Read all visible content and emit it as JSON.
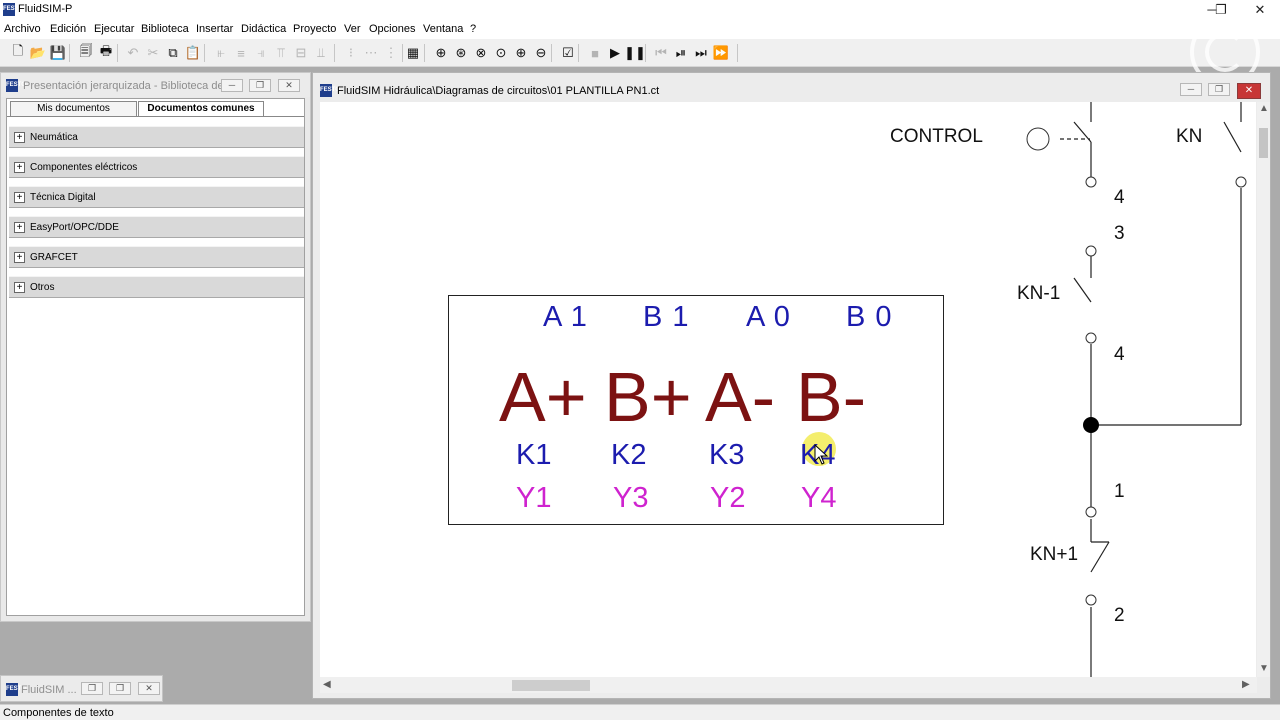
{
  "app": {
    "title": "FluidSIM-P",
    "logo_text": "FESTO",
    "window_controls": {
      "minimize": "─",
      "restore": "❐",
      "close": "✕"
    }
  },
  "menu": [
    "Archivo",
    "Edición",
    "Ejecutar",
    "Biblioteca",
    "Insertar",
    "Didáctica",
    "Proyecto",
    "Ver",
    "Opciones",
    "Ventana",
    "?"
  ],
  "toolbar": {
    "buttons": [
      {
        "icon": "new-document-icon",
        "glyph": "🗋",
        "enabled": true
      },
      {
        "icon": "open-icon",
        "glyph": "📂",
        "enabled": true
      },
      {
        "icon": "save-icon",
        "glyph": "💾",
        "enabled": true
      },
      {
        "icon": "print-preview-icon",
        "glyph": "🗐",
        "enabled": true
      },
      {
        "icon": "print-icon",
        "glyph": "🖶",
        "enabled": true
      },
      {
        "icon": "undo-icon",
        "glyph": "↶",
        "enabled": false
      },
      {
        "icon": "cut-icon",
        "glyph": "✂",
        "enabled": false
      },
      {
        "icon": "copy-icon",
        "glyph": "⧉",
        "enabled": true
      },
      {
        "icon": "paste-icon",
        "glyph": "📋",
        "enabled": true
      },
      {
        "icon": "align-left-icon",
        "glyph": "⫦",
        "enabled": false
      },
      {
        "icon": "align-center-icon",
        "glyph": "≡",
        "enabled": false
      },
      {
        "icon": "align-right-icon",
        "glyph": "⫣",
        "enabled": false
      },
      {
        "icon": "align-top-icon",
        "glyph": "⫪",
        "enabled": false
      },
      {
        "icon": "align-middle-icon",
        "glyph": "⊟",
        "enabled": false
      },
      {
        "icon": "align-bottom-icon",
        "glyph": "⫫",
        "enabled": false
      },
      {
        "icon": "distribute-h-icon",
        "glyph": "⁝",
        "enabled": false
      },
      {
        "icon": "distribute-v-icon",
        "glyph": "⋯",
        "enabled": false
      },
      {
        "icon": "grid-icon",
        "glyph": "⋮",
        "enabled": false
      },
      {
        "icon": "component-list-icon",
        "glyph": "▦",
        "enabled": true
      },
      {
        "icon": "zoom-fit-icon",
        "glyph": "⊕",
        "enabled": true
      },
      {
        "icon": "zoom-window-icon",
        "glyph": "⊛",
        "enabled": true
      },
      {
        "icon": "zoom-previous-icon",
        "glyph": "⊗",
        "enabled": true
      },
      {
        "icon": "zoom-page-icon",
        "glyph": "⊙",
        "enabled": true
      },
      {
        "icon": "zoom-in-icon",
        "glyph": "⊕",
        "enabled": true
      },
      {
        "icon": "zoom-out-icon",
        "glyph": "⊖",
        "enabled": true
      },
      {
        "icon": "check-drawing-icon",
        "glyph": "☑",
        "enabled": true
      },
      {
        "icon": "stop-icon",
        "glyph": "■",
        "enabled": false
      },
      {
        "icon": "play-icon",
        "glyph": "▶",
        "enabled": true
      },
      {
        "icon": "pause-icon",
        "glyph": "❚❚",
        "enabled": true
      },
      {
        "icon": "reset-icon",
        "glyph": "⏮",
        "enabled": false
      },
      {
        "icon": "step-icon",
        "glyph": "⏯",
        "enabled": true
      },
      {
        "icon": "step-to-state-icon",
        "glyph": "⏭",
        "enabled": true
      },
      {
        "icon": "fast-forward-icon",
        "glyph": "⏩",
        "enabled": false
      }
    ]
  },
  "library_panel": {
    "title": "Presentación jerarquizada - Biblioteca de ...",
    "tabs": [
      "Mis documentos",
      "Documentos comunes"
    ],
    "active_tab": 1,
    "categories": [
      "Neumática",
      "Componentes eléctricos",
      "Técnica Digital",
      "EasyPort/OPC/DDE",
      "GRAFCET",
      "Otros"
    ],
    "expand_glyph": "+"
  },
  "minimized_window": {
    "title": "FluidSIM ..."
  },
  "circuit_window": {
    "title": "FluidSIM Hidráulica\\Diagramas de circuitos\\01 PLANTILLA PN1.ct",
    "sequence": {
      "sensors": [
        "A 1",
        "B 1",
        "A 0",
        "B 0"
      ],
      "steps": [
        "A+",
        "B+",
        "A-",
        "B-"
      ],
      "relays": [
        "K1",
        "K2",
        "K3",
        "K4"
      ],
      "coils": [
        "Y1",
        "Y3",
        "Y2",
        "Y4"
      ]
    },
    "ladder": {
      "labels": [
        "CONTROL",
        "KN",
        "4",
        "3",
        "KN-1",
        "4",
        "1",
        "KN+1",
        "2"
      ]
    },
    "scroll_arrows": {
      "up": "▲",
      "down": "▼",
      "left": "◀",
      "right": "▶"
    }
  },
  "statusbar": {
    "text": "Componentes de texto"
  },
  "colors": {
    "step_text": "#7c1212",
    "relay_text": "#1c1cae",
    "coil_text": "#cf23cf",
    "close_button": "#c73636"
  }
}
